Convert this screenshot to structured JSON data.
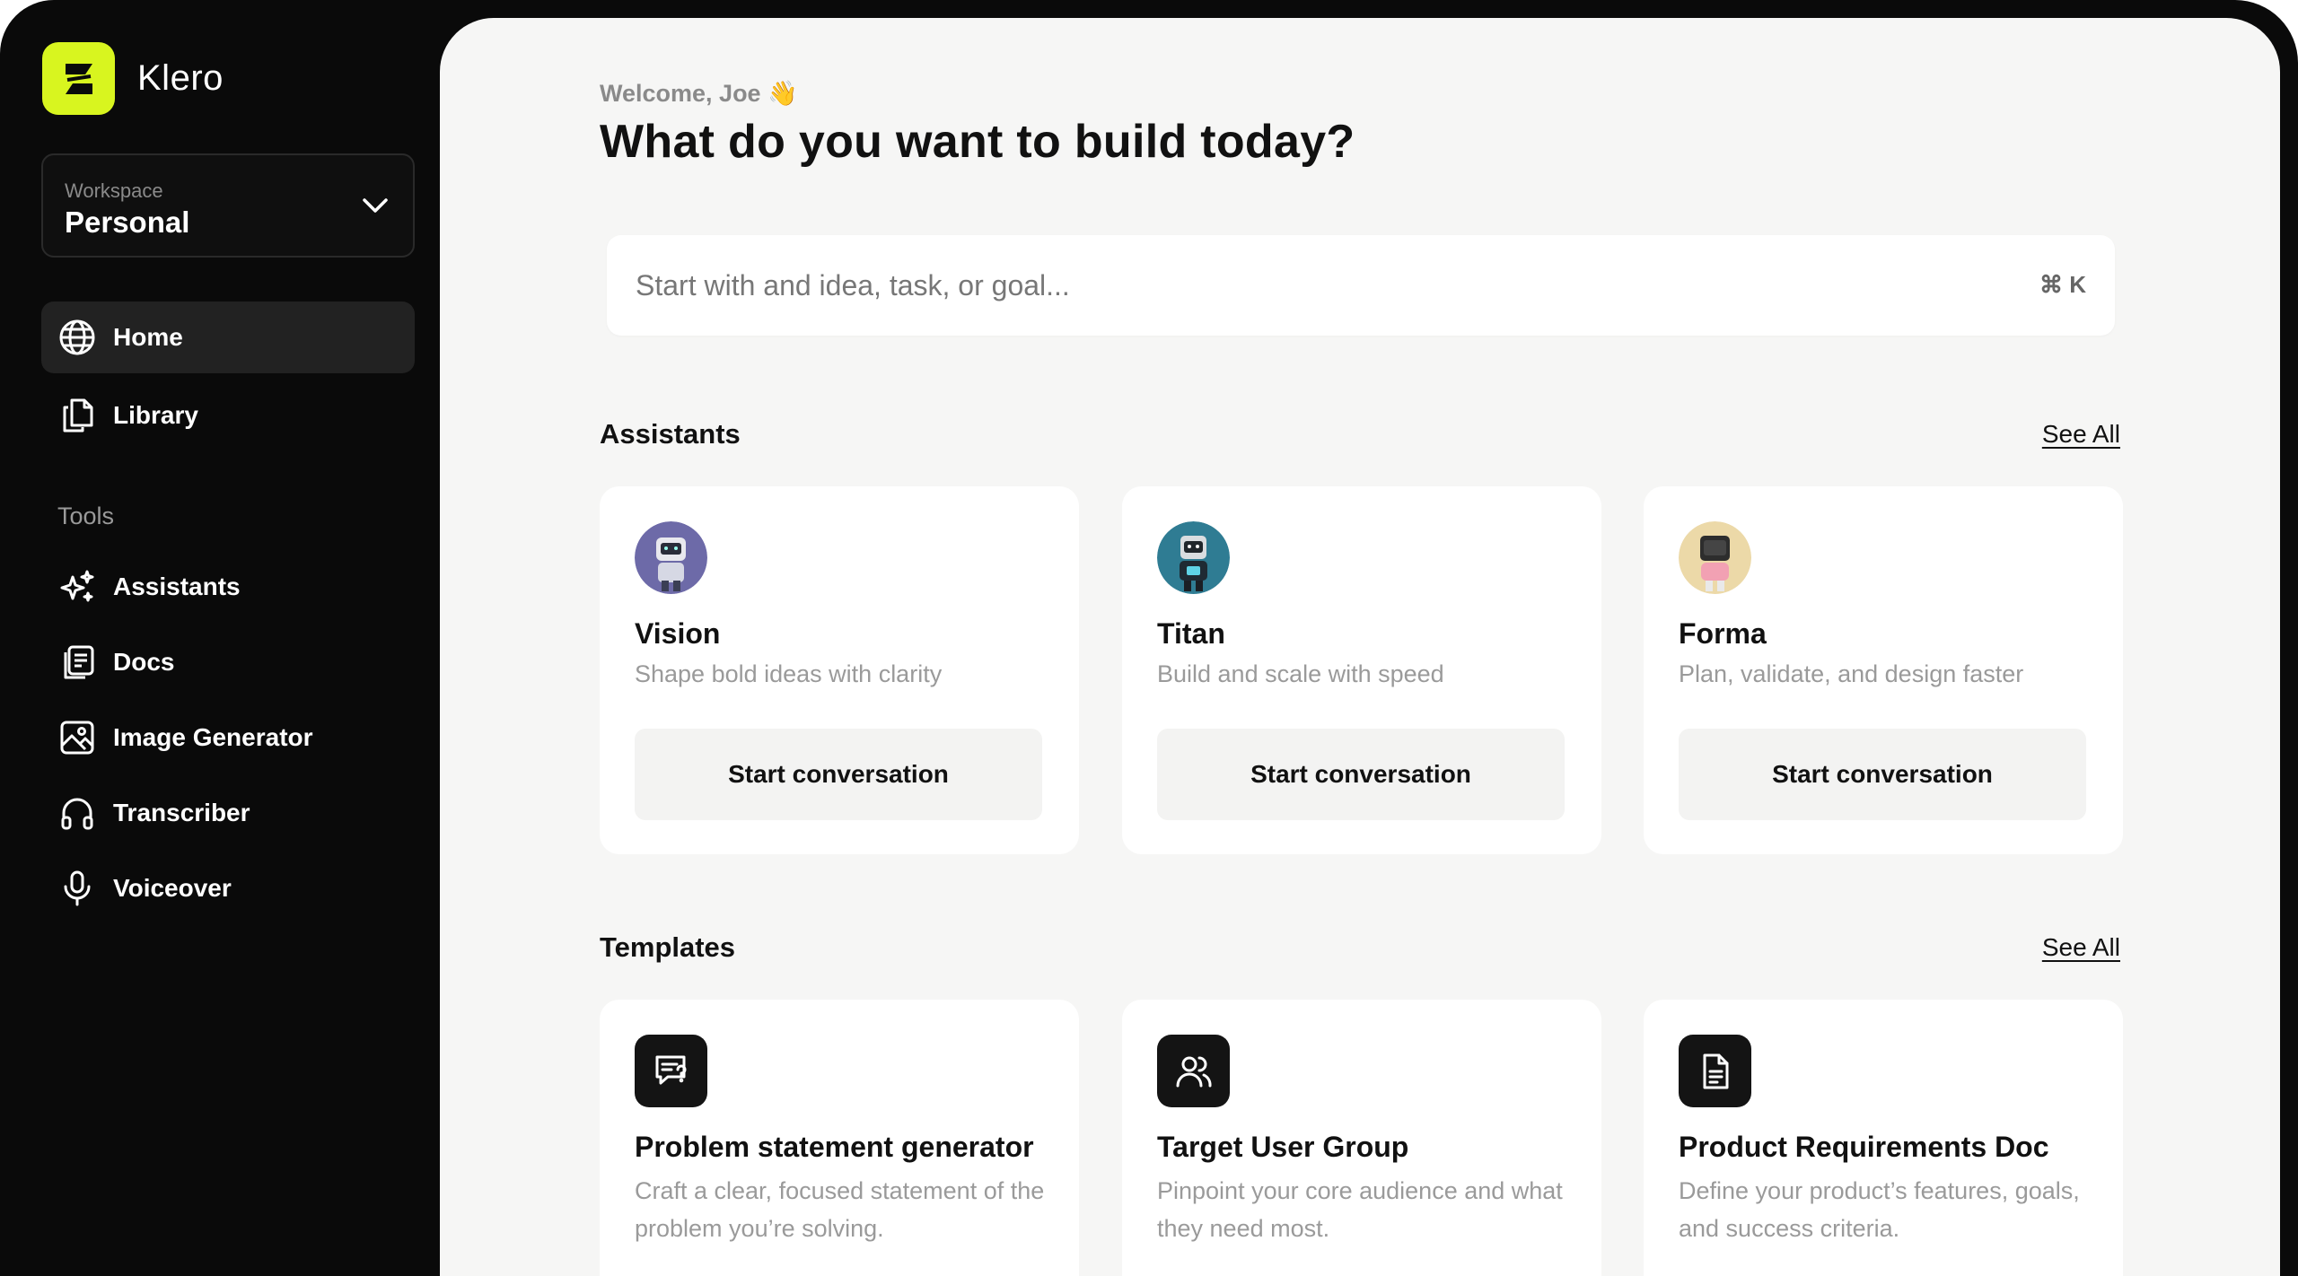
{
  "app": {
    "name": "Klero",
    "accent": "#d8f51f"
  },
  "workspace": {
    "label": "Workspace",
    "value": "Personal"
  },
  "nav": {
    "primary": [
      {
        "label": "Home",
        "icon": "globe-icon",
        "active": true
      },
      {
        "label": "Library",
        "icon": "files-icon",
        "active": false
      }
    ],
    "tools_label": "Tools",
    "tools": [
      {
        "label": "Assistants",
        "icon": "sparkles-icon"
      },
      {
        "label": "Docs",
        "icon": "docs-icon"
      },
      {
        "label": "Image Generator",
        "icon": "image-icon"
      },
      {
        "label": "Transcriber",
        "icon": "headphones-icon"
      },
      {
        "label": "Voiceover",
        "icon": "microphone-icon"
      }
    ]
  },
  "header": {
    "welcome": "Welcome, Joe 👋",
    "title": "What do you want to build today?"
  },
  "search": {
    "placeholder": "Start with and idea, task, or goal...",
    "value": "",
    "shortcut": "⌘ K"
  },
  "assistants": {
    "title": "Assistants",
    "see_all": "See All",
    "items": [
      {
        "name": "Vision",
        "description": "Shape bold ideas with clarity",
        "cta": "Start conversation"
      },
      {
        "name": "Titan",
        "description": "Build and scale with speed",
        "cta": "Start conversation"
      },
      {
        "name": "Forma",
        "description": "Plan, validate, and design faster",
        "cta": "Start conversation"
      }
    ]
  },
  "templates": {
    "title": "Templates",
    "see_all": "See All",
    "items": [
      {
        "name": "Problem statement generator",
        "description": "Craft a clear, focused statement of the problem you’re solving.",
        "icon": "message-question-icon"
      },
      {
        "name": "Target User Group",
        "description": "Pinpoint your core audience and what they need most.",
        "icon": "users-icon"
      },
      {
        "name": "Product Requirements Doc",
        "description": "Define your product’s features, goals, and success criteria.",
        "icon": "document-icon"
      }
    ]
  }
}
